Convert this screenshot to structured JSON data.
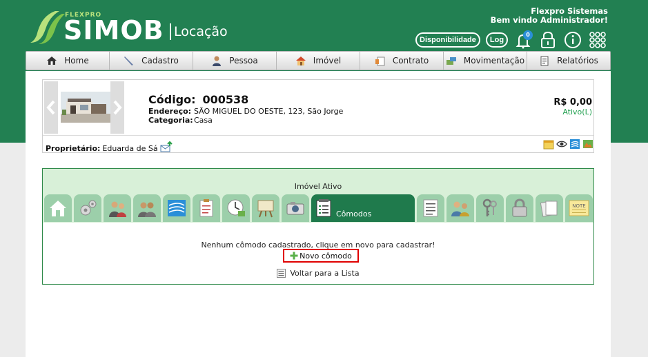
{
  "brand": {
    "tagline": "FLEXPRO",
    "name": "SIMOB",
    "module": "Locação"
  },
  "user": {
    "company": "Flexpro Sistemas",
    "greeting": "Bem vindo Administrador!"
  },
  "toolbar": {
    "availability_label": "Disponibilidade",
    "log_label": "Log",
    "notification_count": "0"
  },
  "nav": {
    "items": [
      {
        "label": "Home",
        "icon": "home-icon"
      },
      {
        "label": "Cadastro",
        "icon": "pencil-icon"
      },
      {
        "label": "Pessoa",
        "icon": "person-icon"
      },
      {
        "label": "Imóvel",
        "icon": "house-icon"
      },
      {
        "label": "Contrato",
        "icon": "contract-icon"
      },
      {
        "label": "Movimentação",
        "icon": "money-icon"
      },
      {
        "label": "Relatórios",
        "icon": "report-icon"
      }
    ]
  },
  "property": {
    "code_label": "Código:",
    "code": "000538",
    "address_label": "Endereço:",
    "address": "SÃO MIGUEL DO OESTE, 123, São Jorge",
    "category_label": "Categoria:",
    "category": "Casa",
    "price": "R$ 0,00",
    "status": "Ativo(L)",
    "owner_label": "Proprietário:",
    "owner": "Eduarda de Sá"
  },
  "tabs": {
    "header": "Imóvel Ativo",
    "active_label": "Cômodos",
    "icons": [
      "home-tab-icon",
      "settings-tab-icon",
      "people-tab-icon",
      "group-tab-icon",
      "flag-tab-icon",
      "checklist-tab-icon",
      "clock-tab-icon",
      "easel-tab-icon",
      "camera-tab-icon",
      "rooms-tab-icon",
      "list-tab-icon",
      "users-tab-icon",
      "keys-tab-icon",
      "lock-tab-icon",
      "documents-tab-icon",
      "note-tab-icon"
    ]
  },
  "content": {
    "empty_message": "Nenhum cômodo cadastrado, clique em novo para cadastrar!",
    "new_button": "Novo cômodo",
    "back_link": "Voltar para a Lista"
  },
  "colors": {
    "brand_green": "#228052",
    "tab_green": "#9ccfaa",
    "active_tab": "#1f7a4c",
    "highlight": "#e00000"
  }
}
